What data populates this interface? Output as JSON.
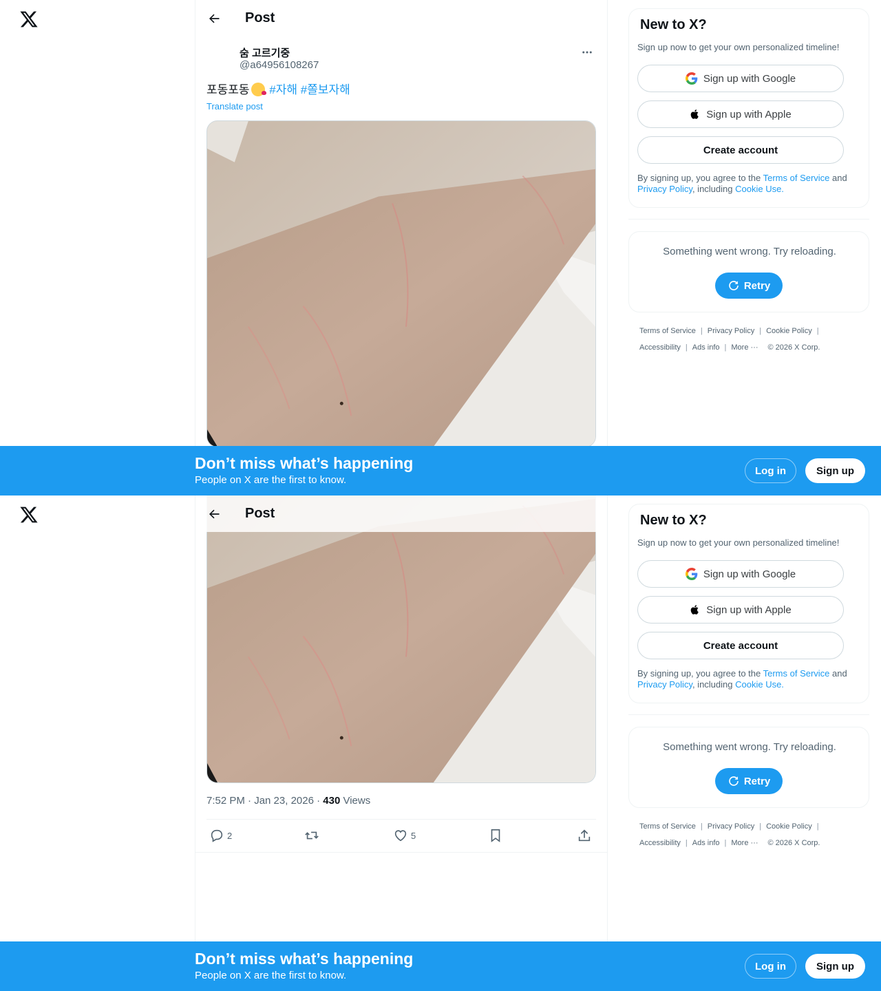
{
  "topbar": {
    "title": "Post"
  },
  "post": {
    "author_name": "숨 고르기중",
    "author_handle": "@a64956108267",
    "text": "포동포동",
    "hashtags": [
      "#자해",
      "#쫄보자해"
    ],
    "translate": "Translate post",
    "time": "7:52 PM · Jan 23, 2026",
    "dot": "·",
    "views_count": "430",
    "views_label": "Views",
    "replies": "2",
    "likes": "5"
  },
  "signup_card": {
    "title": "New to X?",
    "subtitle": "Sign up now to get your own personalized timeline!",
    "google": "Sign up with Google",
    "apple": "Sign up with Apple",
    "create": "Create account",
    "legal_pre": "By signing up, you agree to the ",
    "tos": "Terms of Service",
    "and": " and ",
    "privacy": "Privacy Policy",
    "including": ", including ",
    "cookie": "Cookie Use."
  },
  "error_card": {
    "message": "Something went wrong. Try reloading.",
    "retry": "Retry"
  },
  "footer": {
    "terms": "Terms of Service",
    "privacy": "Privacy Policy",
    "cookie": "Cookie Policy",
    "accessibility": "Accessibility",
    "ads": "Ads info",
    "more": "More ···",
    "copyright": "© 2026 X Corp.",
    "separator": "|"
  },
  "banner": {
    "title": "Don’t miss what’s happening",
    "subtitle": "People on X are the first to know.",
    "login": "Log in",
    "signup": "Sign up"
  },
  "colors": {
    "accent": "#1d9bf0",
    "text": "#0f1419",
    "muted": "#536471",
    "border": "#eff3f4"
  }
}
